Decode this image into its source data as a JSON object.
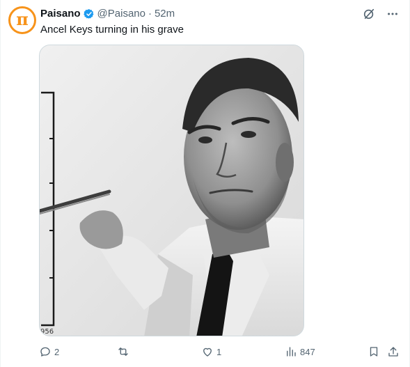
{
  "author": {
    "avatar_glyph": "π",
    "name": "Paisano",
    "handle": "@Paisano",
    "separator": "·",
    "time": "52m",
    "verified": true
  },
  "tweet": {
    "text": "Ancel Keys turning in his grave",
    "image_label": "956"
  },
  "top_icons": [
    "grok-icon",
    "more-icon"
  ],
  "metrics": {
    "replies": "2",
    "reposts": "",
    "likes": "1",
    "views": "847"
  },
  "colors": {
    "accent": "#1d9bf0",
    "muted": "#536471",
    "avatar_brand": "#f7931a"
  }
}
